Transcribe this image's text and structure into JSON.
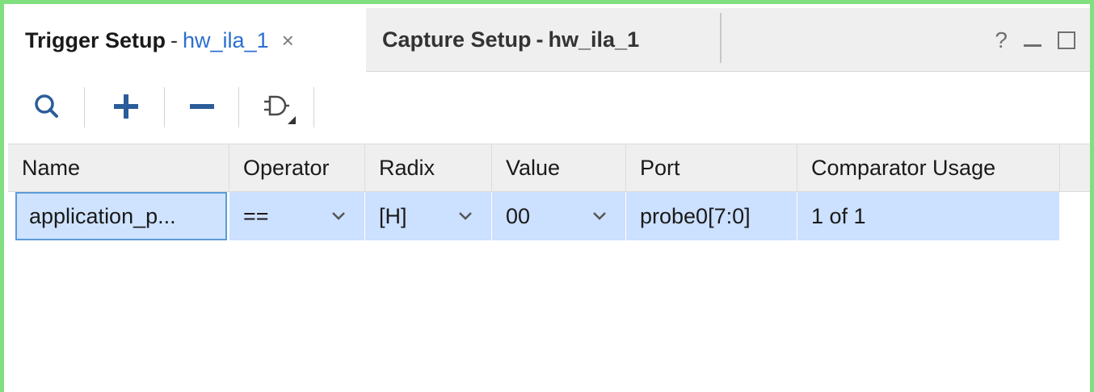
{
  "tabs": [
    {
      "title": "Trigger Setup",
      "separator": "-",
      "subtitle": "hw_ila_1",
      "close": "×",
      "active": true
    },
    {
      "title": "Capture Setup",
      "separator": "-",
      "subtitle": "hw_ila_1",
      "active": false
    }
  ],
  "window_controls": {
    "help": "?"
  },
  "toolbar": {
    "icons": [
      "search-icon",
      "add-icon",
      "remove-icon",
      "logic-gate-icon"
    ]
  },
  "table": {
    "columns": [
      "Name",
      "Operator",
      "Radix",
      "Value",
      "Port",
      "Comparator Usage"
    ],
    "rows": [
      {
        "name": "application_p...",
        "operator": "==",
        "radix": "[H]",
        "value": "00",
        "port": "probe0[7:0]",
        "comparator_usage": "1 of 1"
      }
    ]
  },
  "colors": {
    "frame_border": "#80e080",
    "selected_row": "#cce0ff",
    "tab_link": "#2c6fd1",
    "header_bg": "#efefef"
  }
}
